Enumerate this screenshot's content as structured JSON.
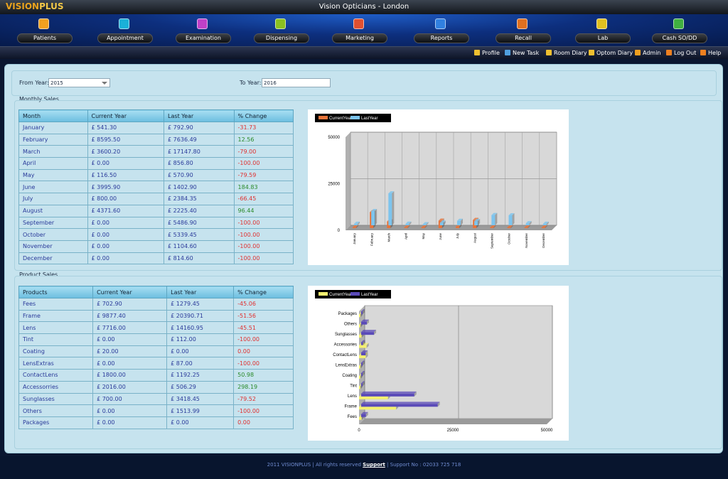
{
  "app": {
    "logo_a": "VISION",
    "logo_b": "PLUS",
    "title": "Vision Opticians - London"
  },
  "nav": [
    {
      "label": "Patients",
      "icon": "patients-icon",
      "color": "#f0a020"
    },
    {
      "label": "Appointment",
      "icon": "appointment-icon",
      "color": "#1ab0d8"
    },
    {
      "label": "Examination",
      "icon": "examination-icon",
      "color": "#c040c8"
    },
    {
      "label": "Dispensing",
      "icon": "dispensing-icon",
      "color": "#8ac020"
    },
    {
      "label": "Marketing",
      "icon": "marketing-icon",
      "color": "#e05030"
    },
    {
      "label": "Reports",
      "icon": "reports-icon",
      "color": "#3080e0"
    },
    {
      "label": "Recall",
      "icon": "recall-icon",
      "color": "#e07020"
    },
    {
      "label": "Lab",
      "icon": "lab-icon",
      "color": "#e0c020"
    },
    {
      "label": "Cash SO/DD",
      "icon": "cash-icon",
      "color": "#40b040"
    }
  ],
  "toolbar": [
    {
      "label": "Profile",
      "icon": "profile-icon",
      "color": "#f0c030"
    },
    {
      "label": "New Task",
      "icon": "new-task-icon",
      "color": "#50a0e0"
    },
    {
      "label": "Room Diary",
      "icon": "room-diary-icon",
      "color": "#f0c030"
    },
    {
      "label": "Optom Diary",
      "icon": "optom-diary-icon",
      "color": "#f0c030"
    },
    {
      "label": "Admin",
      "icon": "admin-gear-icon",
      "color": "#f0a020"
    },
    {
      "label": "Log Out",
      "icon": "logout-icon",
      "color": "#f08020"
    },
    {
      "label": "Help",
      "icon": "help-icon",
      "color": "#f08020"
    }
  ],
  "filters": {
    "from_label": "From Year:",
    "from_value": "2015",
    "to_label": "To Year:",
    "to_value": "2016"
  },
  "monthly": {
    "title": "Monthly Sales",
    "headers": [
      "Month",
      "Current Year",
      "Last Year",
      "% Change"
    ],
    "rows": [
      [
        "January",
        "£ 541.30",
        "£ 792.90",
        "-31.73"
      ],
      [
        "February",
        "£ 8595.50",
        "£ 7636.49",
        "12.56"
      ],
      [
        "March",
        "£ 3600.20",
        "£ 17147.80",
        "-79.00"
      ],
      [
        "April",
        "£ 0.00",
        "£ 856.80",
        "-100.00"
      ],
      [
        "May",
        "£ 116.50",
        "£ 570.90",
        "-79.59"
      ],
      [
        "June",
        "£ 3995.90",
        "£ 1402.90",
        "184.83"
      ],
      [
        "July",
        "£ 800.00",
        "£ 2384.35",
        "-66.45"
      ],
      [
        "August",
        "£ 4371.60",
        "£ 2225.40",
        "96.44"
      ],
      [
        "September",
        "£ 0.00",
        "£ 5486.90",
        "-100.00"
      ],
      [
        "October",
        "£ 0.00",
        "£ 5339.45",
        "-100.00"
      ],
      [
        "November",
        "£ 0.00",
        "£ 1104.60",
        "-100.00"
      ],
      [
        "December",
        "£ 0.00",
        "£ 814.60",
        "-100.00"
      ]
    ]
  },
  "product": {
    "title": "Product Sales",
    "headers": [
      "Products",
      "Current Year",
      "Last Year",
      "% Change"
    ],
    "rows": [
      [
        "Fees",
        "£ 702.90",
        "£ 1279.45",
        "-45.06"
      ],
      [
        "Frame",
        "£ 9877.40",
        "£ 20390.71",
        "-51.56"
      ],
      [
        "Lens",
        "£ 7716.00",
        "£ 14160.95",
        "-45.51"
      ],
      [
        "Tint",
        "£ 0.00",
        "£ 112.00",
        "-100.00"
      ],
      [
        "Coating",
        "£ 20.00",
        "£ 0.00",
        "0.00"
      ],
      [
        "LensExtras",
        "£ 0.00",
        "£ 87.00",
        "-100.00"
      ],
      [
        "ContactLens",
        "£ 1800.00",
        "£ 1192.25",
        "50.98"
      ],
      [
        "Accessorries",
        "£ 2016.00",
        "£ 506.29",
        "298.19"
      ],
      [
        "Sunglasses",
        "£ 700.00",
        "£ 3418.45",
        "-79.52"
      ],
      [
        "Others",
        "£ 0.00",
        "£ 1513.99",
        "-100.00"
      ],
      [
        "Packages",
        "£ 0.00",
        "£ 0.00",
        "0.00"
      ]
    ]
  },
  "chart_data": [
    {
      "type": "bar",
      "legend": [
        "CurrentYear",
        "LastYear"
      ],
      "colors": [
        "#e8743a",
        "#7cc4ee"
      ],
      "categories": [
        "January",
        "February",
        "March",
        "April",
        "May",
        "June",
        "July",
        "August",
        "September",
        "October",
        "November",
        "December"
      ],
      "series": [
        {
          "name": "CurrentYear",
          "values": [
            541.3,
            8595.5,
            3600.2,
            0.0,
            116.5,
            3995.9,
            800.0,
            4371.6,
            0.0,
            0.0,
            0.0,
            0.0
          ]
        },
        {
          "name": "LastYear",
          "values": [
            792.9,
            7636.49,
            17147.8,
            856.8,
            570.9,
            1402.9,
            2384.35,
            2225.4,
            5486.9,
            5339.45,
            1104.6,
            814.6
          ]
        }
      ],
      "yticks": [
        "0",
        "25000",
        "50000"
      ],
      "ylim": [
        0,
        50000
      ]
    },
    {
      "type": "bar",
      "orientation": "horizontal",
      "legend": [
        "CurrentYear",
        "LastYear"
      ],
      "colors": [
        "#f4f070",
        "#5a4ab8"
      ],
      "categories": [
        "Fees",
        "Frame",
        "Lens",
        "Tint",
        "Coating",
        "LensExtras",
        "ContactLens",
        "Accessories",
        "Sunglasses",
        "Others",
        "Packages"
      ],
      "series": [
        {
          "name": "CurrentYear",
          "values": [
            702.9,
            9877.4,
            7716.0,
            0.0,
            20.0,
            0.0,
            1800.0,
            2016.0,
            700.0,
            0.0,
            0.0
          ]
        },
        {
          "name": "LastYear",
          "values": [
            1279.45,
            20390.71,
            14160.95,
            112.0,
            0.0,
            87.0,
            1192.25,
            506.29,
            3418.45,
            1513.99,
            0.0
          ]
        }
      ],
      "xticks": [
        "0",
        "25000",
        "50000"
      ],
      "xlim": [
        0,
        50000
      ]
    }
  ],
  "footer": {
    "prefix": "2011 VISIONPLUS | All rights reserved ",
    "support": "Support",
    "suffix": "  |  Support No : 02033 725 718"
  }
}
